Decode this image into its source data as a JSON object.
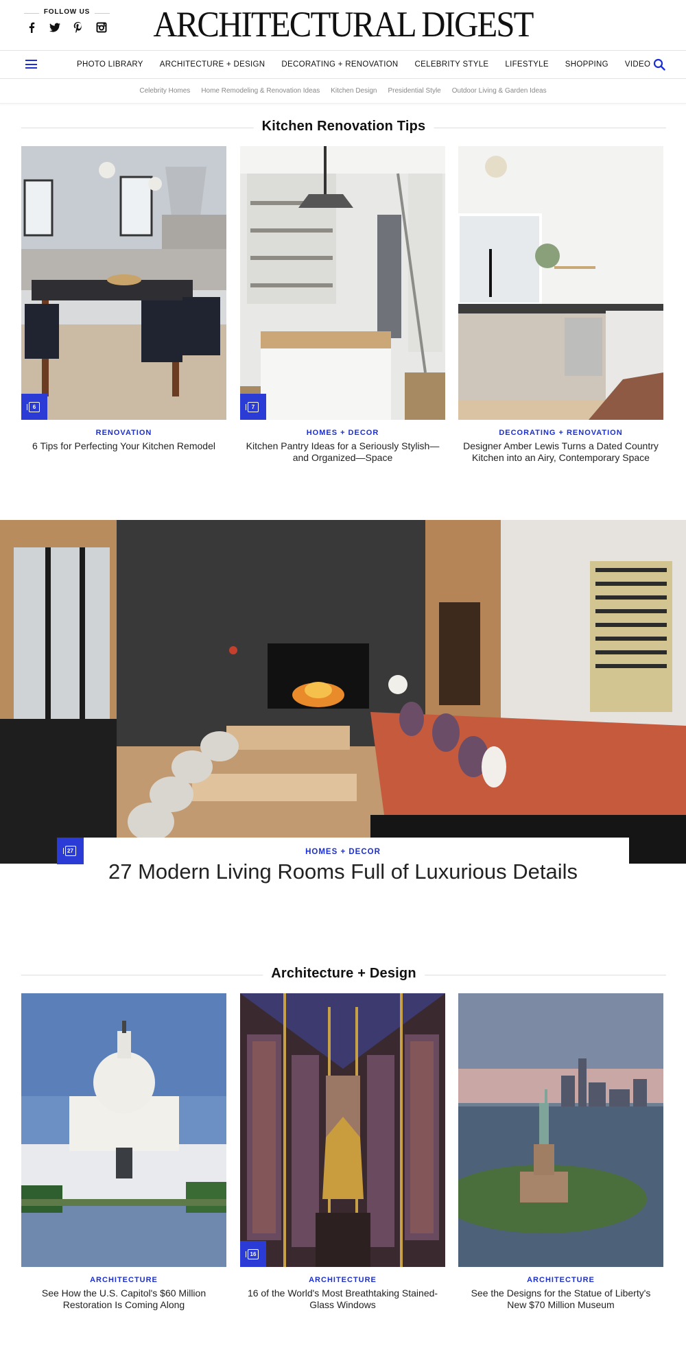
{
  "header": {
    "follow_label": "FOLLOW US",
    "logo": "ARCHITECTURAL DIGEST",
    "social_icons": [
      "facebook-icon",
      "twitter-icon",
      "pinterest-icon",
      "instagram-icon"
    ]
  },
  "nav": {
    "items": [
      "PHOTO LIBRARY",
      "ARCHITECTURE + DESIGN",
      "DECORATING + RENOVATION",
      "CELEBRITY STYLE",
      "LIFESTYLE",
      "SHOPPING",
      "VIDEO"
    ]
  },
  "subnav": {
    "items": [
      "Celebrity Homes",
      "Home Remodeling & Renovation Ideas",
      "Kitchen Design",
      "Presidential Style",
      "Outdoor Living & Garden Ideas"
    ]
  },
  "section1": {
    "heading": "Kitchen Renovation Tips",
    "cards": [
      {
        "rubric": "RENOVATION",
        "title": "6 Tips for Perfecting Your Kitchen Remodel",
        "gallery_count": "6"
      },
      {
        "rubric": "HOMES + DECOR",
        "title": "Kitchen Pantry Ideas for a Seriously Stylish—and Organized—Space",
        "gallery_count": "7"
      },
      {
        "rubric": "DECORATING + RENOVATION",
        "title": "Designer Amber Lewis Turns a Dated Country Kitchen into an Airy, Contemporary Space",
        "gallery_count": ""
      }
    ]
  },
  "hero": {
    "rubric": "HOMES + DECOR",
    "title": "27 Modern Living Rooms Full of Luxurious Details",
    "gallery_count": "27"
  },
  "section2": {
    "heading": "Architecture + Design",
    "cards": [
      {
        "rubric": "ARCHITECTURE",
        "title": "See How the U.S. Capitol's $60 Million Restoration Is Coming Along",
        "gallery_count": ""
      },
      {
        "rubric": "ARCHITECTURE",
        "title": "16 of the World's Most Breathtaking Stained-Glass Windows",
        "gallery_count": "16"
      },
      {
        "rubric": "ARCHITECTURE",
        "title": "See the Designs for the Statue of Liberty's New $70 Million Museum",
        "gallery_count": ""
      }
    ]
  },
  "colors": {
    "accent": "#1a2ed1",
    "badge": "#2b3bd6"
  }
}
